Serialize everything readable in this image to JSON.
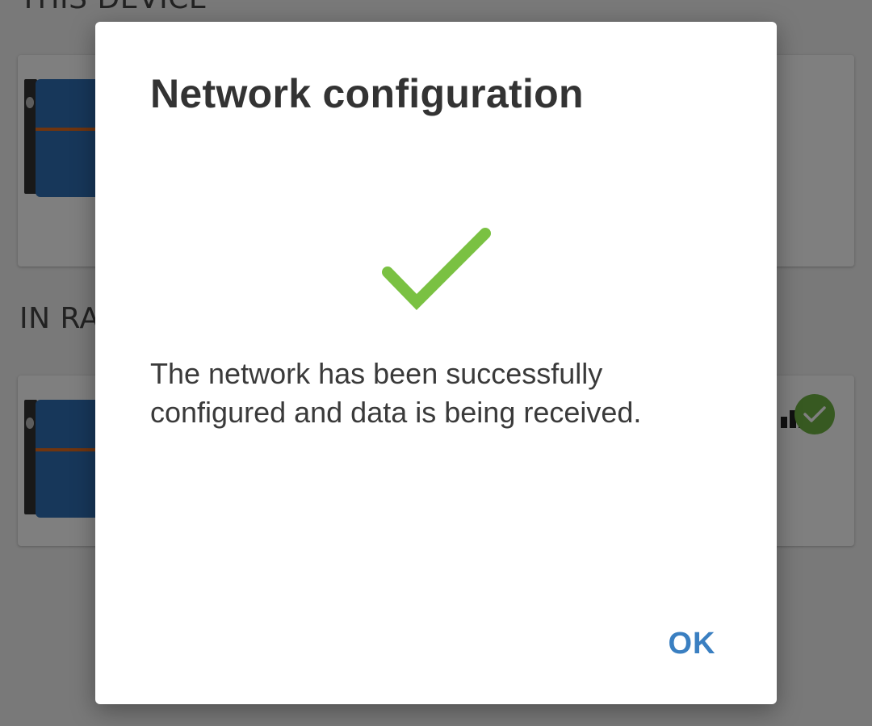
{
  "background": {
    "sections": {
      "this_device": "THIS DEVICE",
      "in_range": "IN RA"
    },
    "icons": {
      "device_image": "device-thumbnail",
      "signal": "signal-strength-icon",
      "status": "check-circle-icon"
    }
  },
  "dialog": {
    "title": "Network configuration",
    "success_icon": "checkmark-icon",
    "message": "The network has been successfully configured and data is being received.",
    "ok_label": "OK"
  },
  "colors": {
    "accent": "#3a7fc1",
    "success": "#7ac142",
    "status_badge": "#6fb343"
  }
}
